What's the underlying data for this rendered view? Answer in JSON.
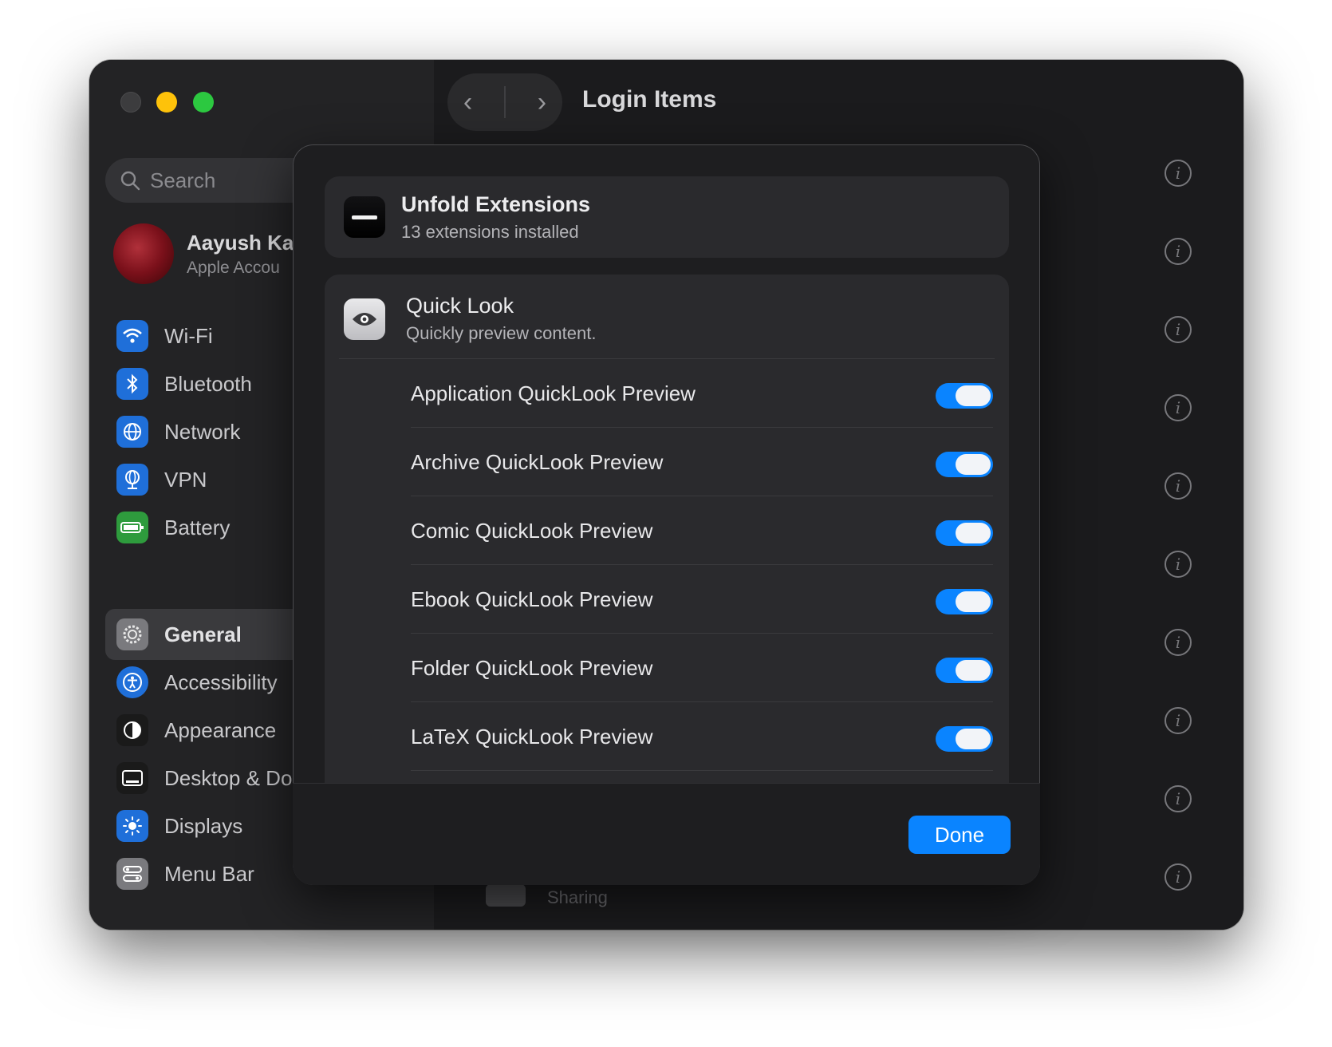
{
  "window": {
    "title": "Login Items"
  },
  "sidebar": {
    "search_placeholder": "Search",
    "account": {
      "name": "Aayush Ka",
      "subtitle": "Apple Accou"
    },
    "items": [
      {
        "label": "Wi-Fi",
        "icon": "wifi-icon",
        "color": "#1f6fd9"
      },
      {
        "label": "Bluetooth",
        "icon": "bluetooth-icon",
        "color": "#1f6fd9"
      },
      {
        "label": "Network",
        "icon": "globe-icon",
        "color": "#1f6fd9"
      },
      {
        "label": "VPN",
        "icon": "vpn-globe-icon",
        "color": "#1f6fd9"
      },
      {
        "label": "Battery",
        "icon": "battery-icon",
        "color": "#2e9b3d"
      },
      {
        "label": "General",
        "icon": "gear-icon",
        "color": "#7a7a7e",
        "selected": true
      },
      {
        "label": "Accessibility",
        "icon": "accessibility-icon",
        "color": "#1f6fd9"
      },
      {
        "label": "Appearance",
        "icon": "appearance-icon",
        "color": "#1a1a1a"
      },
      {
        "label": "Desktop & Do",
        "icon": "desktop-dock-icon",
        "color": "#1a1a1a"
      },
      {
        "label": "Displays",
        "icon": "sun-icon",
        "color": "#1f6fd9"
      },
      {
        "label": "Menu Bar",
        "icon": "menubar-icon",
        "color": "#7a7a7e"
      }
    ]
  },
  "background": {
    "partial_item": "Sharing"
  },
  "sheet": {
    "header": {
      "title": "Unfold Extensions",
      "subtitle": "13 extensions installed"
    },
    "section": {
      "title": "Quick Look",
      "subtitle": "Quickly preview content.",
      "rows": [
        {
          "label": "Application QuickLook Preview",
          "enabled": true
        },
        {
          "label": "Archive QuickLook Preview",
          "enabled": true
        },
        {
          "label": "Comic QuickLook Preview",
          "enabled": true
        },
        {
          "label": "Ebook QuickLook Preview",
          "enabled": true
        },
        {
          "label": "Folder QuickLook Preview",
          "enabled": true
        },
        {
          "label": "LaTeX QuickLook Preview",
          "enabled": true
        }
      ]
    },
    "done_label": "Done"
  },
  "colors": {
    "accent": "#0a84ff"
  }
}
